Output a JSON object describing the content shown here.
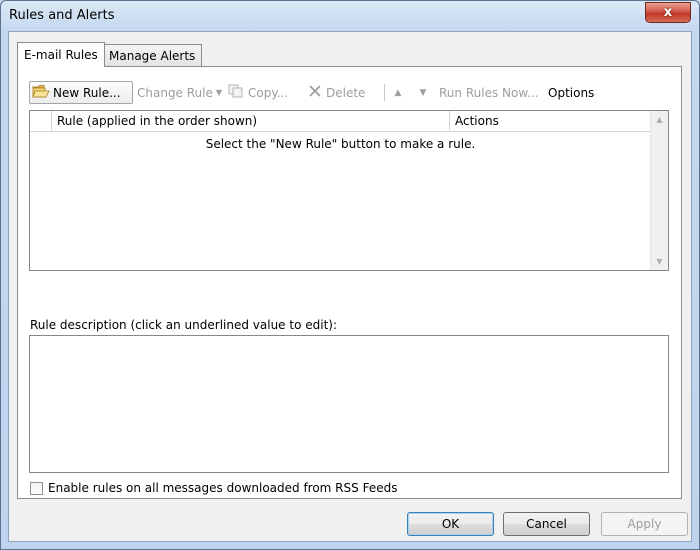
{
  "window": {
    "title": "Rules and Alerts",
    "close_glyph": "x"
  },
  "tabs": [
    {
      "label": "E-mail Rules",
      "active": true
    },
    {
      "label": "Manage Alerts",
      "active": false
    }
  ],
  "toolbar": {
    "new_rule": {
      "label": "New Rule...",
      "icon": "folder-icon",
      "enabled": true
    },
    "change_rule": {
      "label": "Change Rule",
      "enabled": false
    },
    "copy": {
      "label": "Copy...",
      "icon": "copy-icon",
      "enabled": false
    },
    "delete": {
      "label": "Delete",
      "icon": "delete-x-icon",
      "enabled": false
    },
    "move_up": {
      "icon": "arrow-up-icon",
      "enabled": false
    },
    "move_down": {
      "icon": "arrow-down-icon",
      "enabled": false
    },
    "run_rules_now": {
      "label": "Run Rules Now...",
      "enabled": false
    },
    "options": {
      "label": "Options",
      "enabled": true
    }
  },
  "rules_list": {
    "columns": [
      "Rule (applied in the order shown)",
      "Actions"
    ],
    "empty_message": "Select the \"New Rule\" button to make a rule.",
    "rows": []
  },
  "rule_description": {
    "label": "Rule description (click an underlined value to edit):",
    "text": ""
  },
  "rss_checkbox": {
    "label": "Enable rules on all messages downloaded from RSS Feeds",
    "checked": false
  },
  "buttons": {
    "ok": "OK",
    "cancel": "Cancel",
    "apply": "Apply"
  }
}
